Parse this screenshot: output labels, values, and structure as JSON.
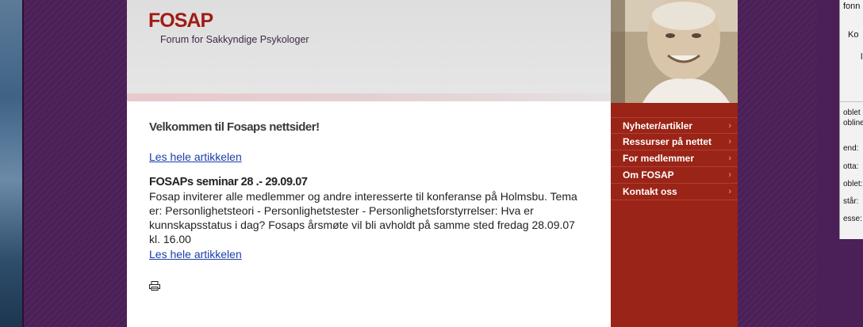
{
  "site": {
    "logo": "FOSAP",
    "tagline": "Forum for Sakkyndige Psykologer"
  },
  "content": {
    "welcome_heading": "Velkommen til Fosaps nettsider!",
    "first_link": "Les hele artikkelen",
    "article_title": "FOSAPs seminar 28 .- 29.09.07",
    "article_body": "Fosap inviterer alle medlemmer og andre interesserte til konferanse på Holmsbu. Tema er: Personlighetsteori - Personlighetstester - Personlighetsforstyrrelser: Hva er kunnskapsstatus i dag? Fosaps årsmøte vil bli avholdt på samme sted fredag 28.09.07 kl. 16.00",
    "second_link": "Les hele artikkelen"
  },
  "nav": {
    "items": [
      {
        "label": "Nyheter/artikler"
      },
      {
        "label": "Ressurser på nettet"
      },
      {
        "label": "For medlemmer"
      },
      {
        "label": "Om FOSAP"
      },
      {
        "label": "Kontakt oss"
      }
    ],
    "arrow_glyph": "›"
  },
  "right_window": {
    "fragments": [
      "fonn",
      "Ko",
      "l",
      "oblet",
      "obline",
      "end:",
      "otta:",
      "oblet:",
      "står:",
      "esse:"
    ]
  },
  "colors": {
    "brand_red": "#a01c14",
    "nav_bg": "#9a2417",
    "background_purple": "#4b1f57",
    "link_blue": "#1a3ea8"
  },
  "icons": {
    "print": "printer-icon"
  }
}
